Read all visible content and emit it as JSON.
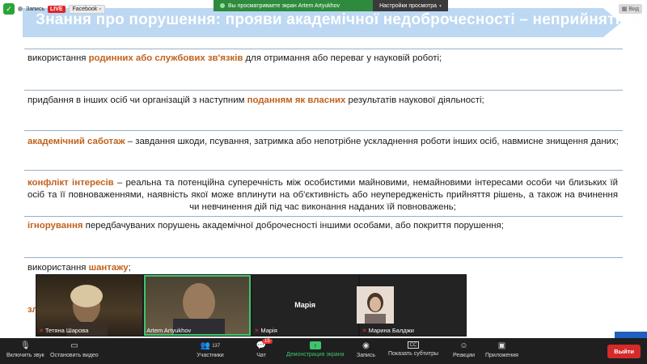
{
  "topbar": {
    "recording_label": "Запись",
    "live_label": "LIVE",
    "facebook_label": "Facebook",
    "share_status": "Вы просматриваете экран Artem Artyukhov",
    "view_options": "Настройки просмотра",
    "view_button": "Вид"
  },
  "slide": {
    "title": "Знання про порушення: прояви академічної недоброчесності – неприйнятні практики",
    "rows": [
      {
        "pre": "використання ",
        "hl": "родинних або службових зв'язків",
        "post": " для отримання або переваг у науковій роботі;"
      },
      {
        "pre": "придбання в інших осіб чи організацій з наступним ",
        "hl": "поданням як власних",
        "post": " результатів наукової діяльності;"
      },
      {
        "pre": "",
        "hl": "академічний саботаж",
        "post": " – завдання шкоди, псування, затримка або непотрібне ускладнення  роботи інших осіб, навмисне знищення даних;"
      },
      {
        "pre": "",
        "hl": "конфлікт інтересів",
        "post": " – реальна та потенційна суперечність між особистими майновими, немайновими інтересами особи чи близьких їй осіб та її повноваженнями, наявність якої може вплинути на об'єктивність або неупередженість прийняття рішень, а також на вчинення чи невчинення дій під час виконання наданих їй повноважень;"
      },
      {
        "pre": "",
        "hl": "ігнорування",
        "post": " передбачуваних порушень академічної доброчесності іншими особами, або покриття порушення;"
      },
      {
        "pre": "використання ",
        "hl": "шантажу",
        "post": ";"
      }
    ],
    "partial_row": "зл"
  },
  "videos": [
    {
      "name": "Тетяна Шарова",
      "muted": true
    },
    {
      "name": "Artem Artyukhov",
      "muted": false
    },
    {
      "name": "Марія",
      "muted": true,
      "display_name": "Марія"
    },
    {
      "name": "Марина Балджи",
      "muted": true
    }
  ],
  "toolbar": {
    "audio": "Включить звук",
    "video": "Остановить видео",
    "participants": "Участники",
    "participants_count": "137",
    "chat": "Чат",
    "chat_badge": "15",
    "share": "Демонстрация экрана",
    "record": "Запись",
    "subtitles": "Показать субтитры",
    "subtitles_icon_text": "CC",
    "reactions": "Реакции",
    "apps": "Приложения",
    "exit": "Выйти"
  }
}
